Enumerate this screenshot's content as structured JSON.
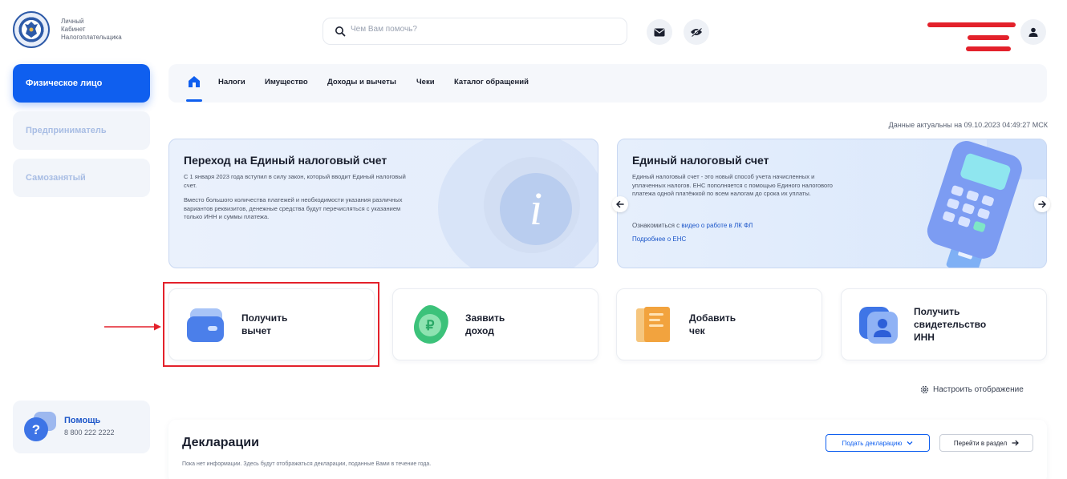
{
  "header": {
    "logo_lines": [
      "Личный",
      "Кабинет",
      "Налогоплательщика"
    ],
    "search_placeholder": "Чем Вам помочь?",
    "icons": [
      "mail-icon",
      "eye-off-icon",
      "user-icon"
    ]
  },
  "sidebar": {
    "items": [
      {
        "label": "Физическое лицо",
        "active": true
      },
      {
        "label": "Предприниматель",
        "active": false
      },
      {
        "label": "Самозанятый",
        "active": false
      }
    ],
    "help": {
      "title": "Помощь",
      "phone": "8 800 222 2222"
    }
  },
  "tabs": [
    "Налоги",
    "Имущество",
    "Доходы и вычеты",
    "Чеки",
    "Каталог обращений"
  ],
  "actual_date": "Данные актуальны на 09.10.2023 04:49:27 МСК",
  "banner1": {
    "title": "Переход на Единый налоговый счет",
    "p1": "С 1 января 2023 года вступил в силу закон, который вводит Единый налоговый счет.",
    "p2": "Вместо большого количества платежей и необходимости указания различных вариантов реквизитов, денежные средства будут перечисляться с указанием только ИНН и суммы платежа.",
    "icon_glyph": "i"
  },
  "banner2": {
    "title": "Единый налоговый счет",
    "text": "Единый налоговый счет - это новый способ учета начисленных и уплаченных налогов. ЕНС пополняется с помощью Единого налогового платежа одной платёжкой по всем налогам до срока их уплаты.",
    "intro_prefix": "Ознакомиться с ",
    "intro_link": "видео о работе в ЛК ФЛ",
    "more_link": "Подробнее о ЕНС"
  },
  "cards": [
    {
      "line1": "Получить",
      "line2": "вычет",
      "line3": ""
    },
    {
      "line1": "Заявить",
      "line2": "доход",
      "line3": ""
    },
    {
      "line1": "Добавить",
      "line2": "чек",
      "line3": ""
    },
    {
      "line1": "Получить",
      "line2": "свидетельство",
      "line3": "ИНН"
    }
  ],
  "configure_label": "Настроить отображение",
  "declarations": {
    "title": "Декларации",
    "note": "Пока нет информации. Здесь будут отображаться декларации, поданные Вами в течение года.",
    "file_button": "Подать декларацию",
    "go_button": "Перейти в раздел"
  },
  "colors": {
    "accent": "#0f5fef",
    "highlight": "#e3212b"
  }
}
